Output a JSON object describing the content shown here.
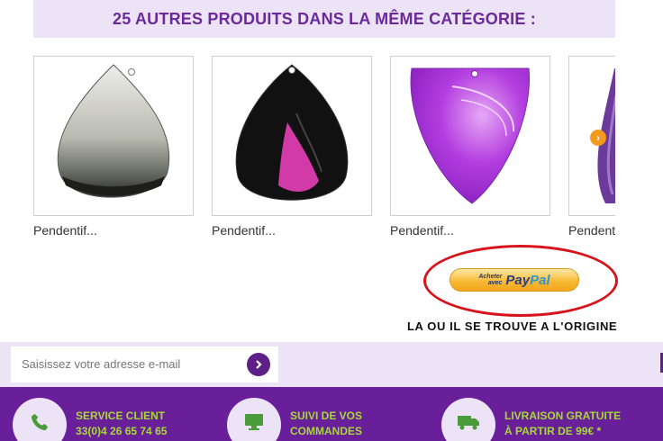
{
  "category_header": {
    "title": "25 AUTRES PRODUITS DANS LA MÊME CATÉGORIE :"
  },
  "products": [
    {
      "name": "Pendentif..."
    },
    {
      "name": "Pendentif..."
    },
    {
      "name": "Pendentif..."
    },
    {
      "name": "Pendentif..."
    }
  ],
  "paypal": {
    "small_text_1": "Acheter",
    "small_text_2": "avec",
    "logo_pay": "Pay",
    "logo_pal": "Pal"
  },
  "annotation": {
    "text": "LA OU IL SE TROUVE A L'ORIGINE"
  },
  "newsletter": {
    "placeholder": "Saisissez votre adresse e-mail"
  },
  "services": [
    {
      "line1": "SERVICE CLIENT",
      "line2": "33(0)4 26 65 74 65",
      "icon": "phone-icon"
    },
    {
      "line1": "SUIVI DE VOS",
      "line2": "COMMANDES",
      "icon": "monitor-icon"
    },
    {
      "line1": "LIVRAISON GRATUITE",
      "line2": "À PARTIR DE 99€ *",
      "icon": "truck-icon"
    }
  ],
  "colors": {
    "accent_purple": "#6a1f9a",
    "light_purple": "#ece3f6",
    "green_text": "#a6d83a",
    "arrow_orange": "#f39a1e",
    "annotation_red": "#d8141b"
  }
}
